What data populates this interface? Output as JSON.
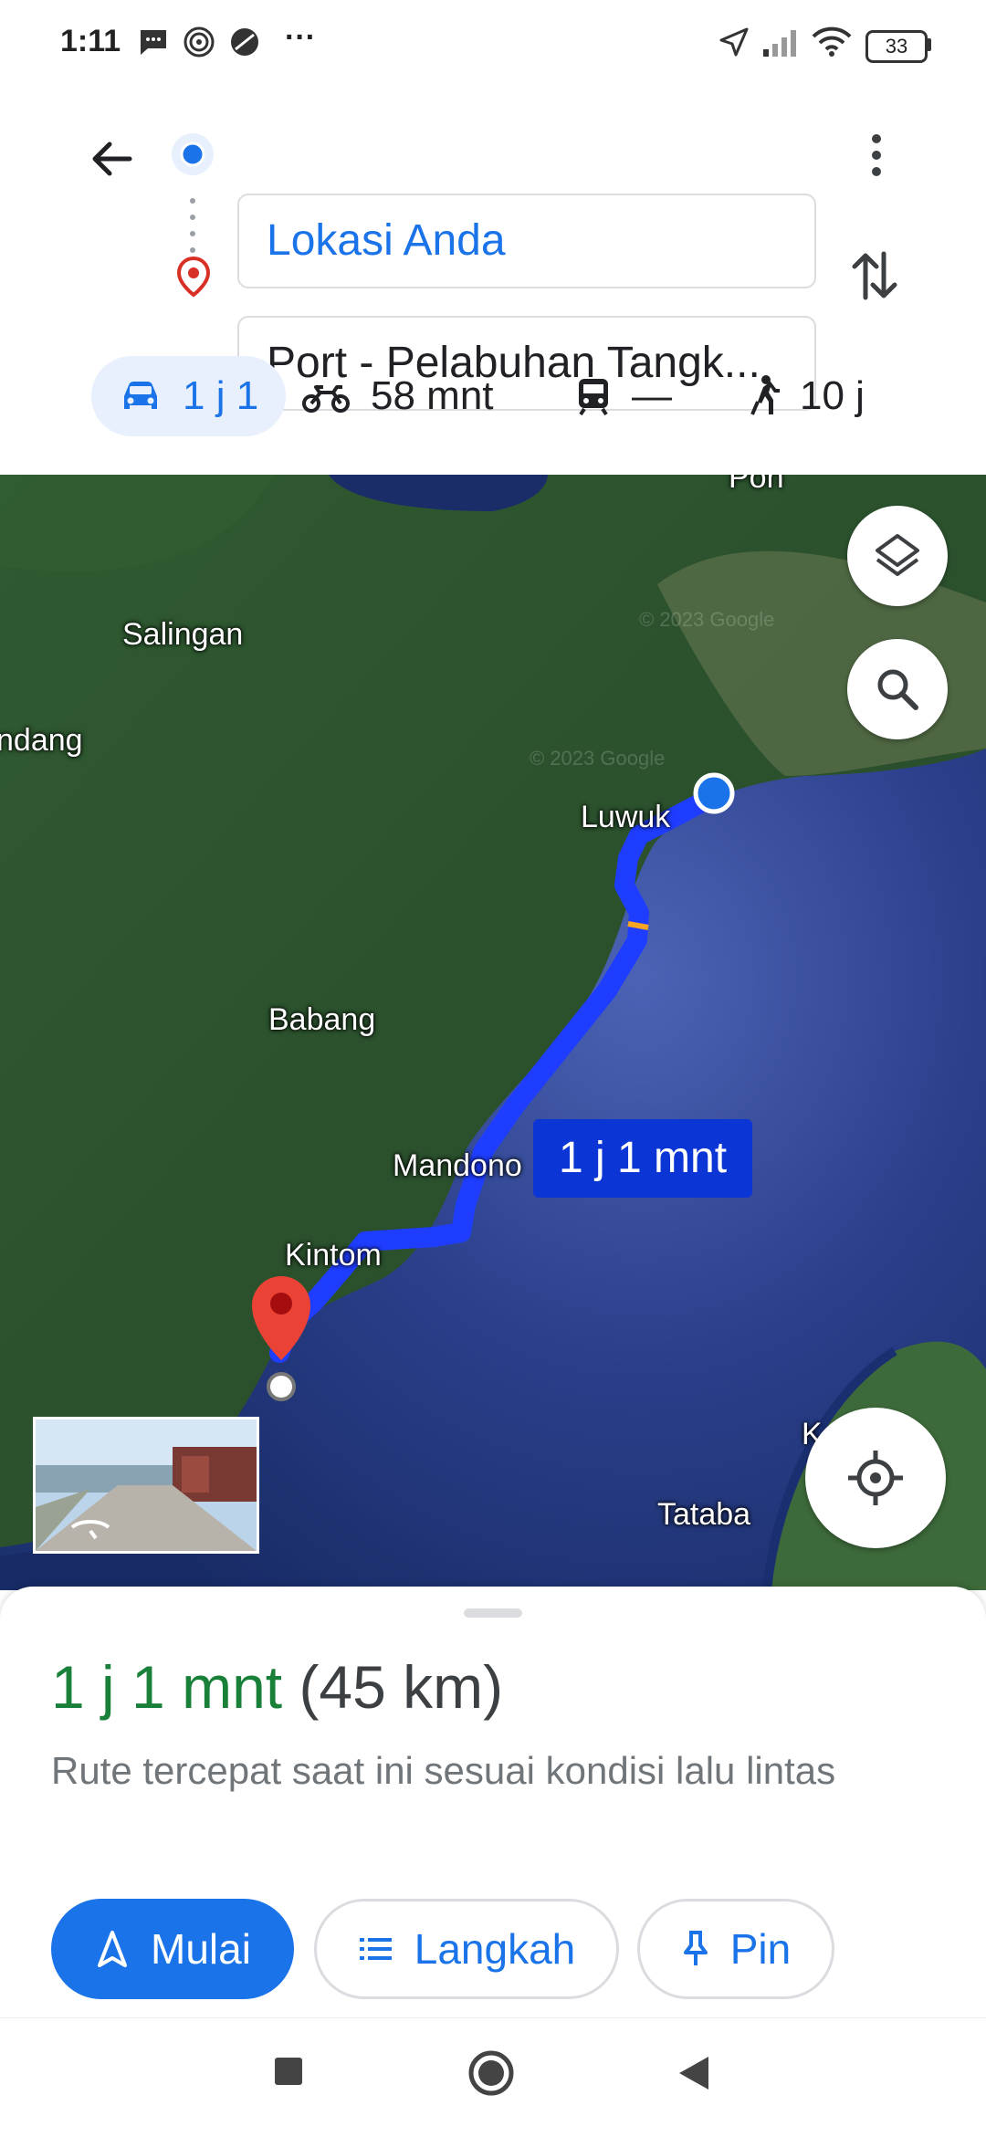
{
  "status_bar": {
    "time": "1:11",
    "overflow": "···",
    "battery": "33"
  },
  "header": {
    "origin": "Lokasi Anda",
    "destination": "Port - Pelabuhan Tangk..."
  },
  "modes": [
    {
      "label": "1 j 1",
      "icon": "car-icon",
      "active": true
    },
    {
      "label": "58 mnt",
      "icon": "motorcycle-icon"
    },
    {
      "label": "—",
      "icon": "train-icon"
    },
    {
      "label": "10 j",
      "icon": "walk-icon"
    }
  ],
  "map": {
    "places": {
      "salingan": "Salingan",
      "ndang": "ndang",
      "luwuk": "Luwuk",
      "babang": "Babang",
      "mandono": "Mandono",
      "kintom": "Kintom",
      "tataba": "Tataba",
      "poh": "Poh",
      "k": "K"
    },
    "eta_bubble": "1 j 1 mnt",
    "watermark": "© 2023 Google",
    "colors": {
      "route": "#1f3dff",
      "sea": "#1e3a7a",
      "land": "#2e5630"
    }
  },
  "sheet": {
    "duration": "1 j 1 mnt",
    "distance": "(45 km)",
    "description": "Rute tercepat saat ini sesuai kondisi lalu lintas",
    "buttons": {
      "start": "Mulai",
      "steps": "Langkah",
      "pin": "Pin"
    }
  },
  "accent": "#1a73e8"
}
